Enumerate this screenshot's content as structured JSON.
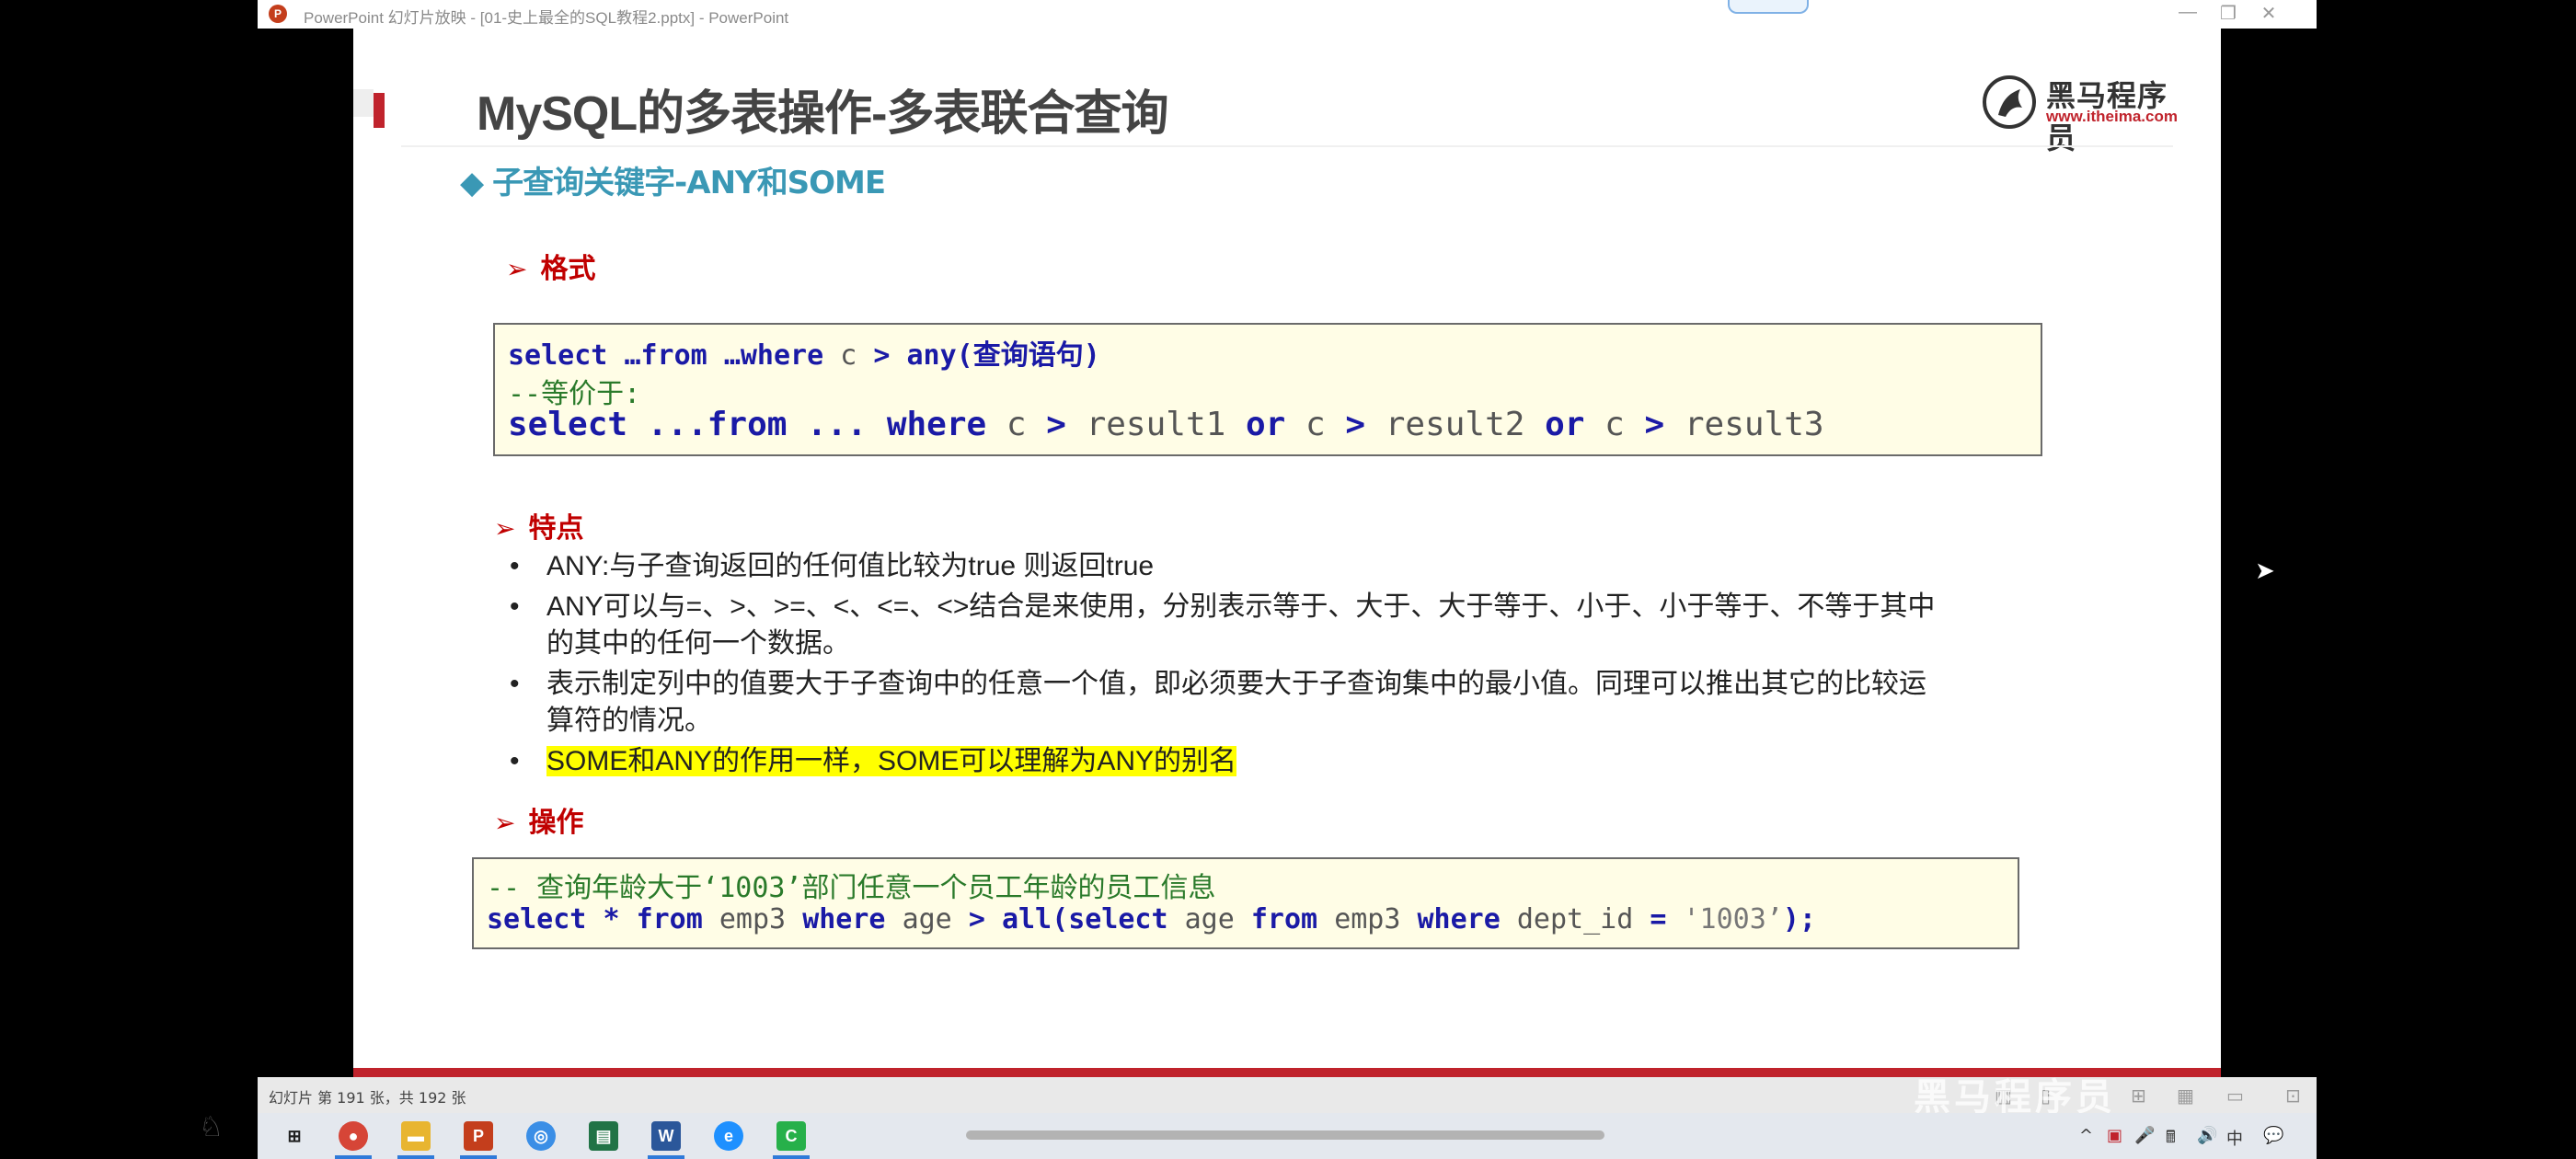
{
  "window": {
    "title": "PowerPoint 幻灯片放映 - [01-史上最全的SQL教程2.pptx] - PowerPoint",
    "app_icon": "P",
    "controls": [
      "—",
      "❐",
      "✕"
    ]
  },
  "slide": {
    "title": "MySQL的多表操作-多表联合查询",
    "logo": {
      "name": "黑马程序员",
      "url": "www.itheima.com"
    },
    "subtitle_marker": "◆",
    "subtitle": "子查询关键字-ANY和SOME",
    "sections": {
      "format": "格式",
      "features": "特点",
      "operation": "操作"
    },
    "section_arrow": "➢",
    "format_code": [
      [
        {
          "t": "select ",
          "k": "kw"
        },
        {
          "t": "…from ",
          "k": "kw"
        },
        {
          "t": "…where ",
          "k": "kw"
        },
        {
          "t": "c ",
          "k": ""
        },
        {
          "t": "> ",
          "k": "kw"
        },
        {
          "t": "any(查询语句)",
          "k": "kw"
        }
      ],
      [
        {
          "t": "--等价于:",
          "k": "cm"
        }
      ],
      [
        {
          "t": "select ",
          "k": "kw"
        },
        {
          "t": "...from ",
          "k": "kw"
        },
        {
          "t": "... ",
          "k": "kw"
        },
        {
          "t": "where ",
          "k": "kw"
        },
        {
          "t": "c ",
          "k": ""
        },
        {
          "t": "> ",
          "k": "kw"
        },
        {
          "t": "result1 ",
          "k": ""
        },
        {
          "t": "or ",
          "k": "kw"
        },
        {
          "t": "c ",
          "k": ""
        },
        {
          "t": "> ",
          "k": "kw"
        },
        {
          "t": "result2 ",
          "k": ""
        },
        {
          "t": "or ",
          "k": "kw"
        },
        {
          "t": "c ",
          "k": ""
        },
        {
          "t": "> ",
          "k": "kw"
        },
        {
          "t": "result3",
          "k": ""
        }
      ]
    ],
    "features": [
      {
        "text": "ANY:与子查询返回的任何值比较为true 则返回true",
        "highlight": false
      },
      {
        "text": "ANY可以与=、>、>=、<、<=、<>结合是来使用，分别表示等于、大于、大于等于、小于、小于等于、不等于其中的其中的任何一个数据。",
        "highlight": false
      },
      {
        "text": "表示制定列中的值要大于子查询中的任意一个值，即必须要大于子查询集中的最小值。同理可以推出其它的比较运算符的情况。",
        "highlight": false
      },
      {
        "text": "SOME和ANY的作用一样，SOME可以理解为ANY的别名",
        "highlight": true
      }
    ],
    "bullet_char": "•",
    "op_code": [
      [
        {
          "t": "-- 查询年龄大于‘1003’部门任意一个员工年龄的员工信息",
          "k": "cm"
        }
      ],
      [
        {
          "t": "select ",
          "k": "kw"
        },
        {
          "t": "* ",
          "k": "kw"
        },
        {
          "t": "from ",
          "k": "kw"
        },
        {
          "t": "emp3 ",
          "k": ""
        },
        {
          "t": "where ",
          "k": "kw"
        },
        {
          "t": "age ",
          "k": ""
        },
        {
          "t": "> ",
          "k": "kw"
        },
        {
          "t": "all(",
          "k": "kw"
        },
        {
          "t": "select ",
          "k": "kw"
        },
        {
          "t": "age ",
          "k": ""
        },
        {
          "t": "from ",
          "k": "kw"
        },
        {
          "t": "emp3 ",
          "k": ""
        },
        {
          "t": "where ",
          "k": "kw"
        },
        {
          "t": "dept_id ",
          "k": ""
        },
        {
          "t": "= ",
          "k": "kw"
        },
        {
          "t": "'1003’",
          "k": "str"
        },
        {
          "t": ");",
          "k": "kw"
        }
      ]
    ]
  },
  "statusbar": {
    "slide_counter": "幻灯片 第 191 张，共 192 张",
    "watermark": "黑马程序员"
  },
  "taskbar": {
    "apps": [
      {
        "name": "windows-start",
        "glyph": "⊞",
        "color": "#1e1e1e"
      },
      {
        "name": "chrome",
        "glyph": "●",
        "color": "#d64537"
      },
      {
        "name": "file-explorer",
        "glyph": "▬",
        "color": "#e8b530"
      },
      {
        "name": "powerpoint",
        "glyph": "P",
        "color": "#c43e1c"
      },
      {
        "name": "browser-2",
        "glyph": "◎",
        "color": "#3a8ee6"
      },
      {
        "name": "excel-chart",
        "glyph": "▤",
        "color": "#217346"
      },
      {
        "name": "word",
        "glyph": "W",
        "color": "#2b579a"
      },
      {
        "name": "edge",
        "glyph": "e",
        "color": "#1e90ff"
      },
      {
        "name": "green-app",
        "glyph": "C",
        "color": "#27b04a"
      }
    ],
    "tray": [
      "^",
      "▣",
      "🎤",
      "🖩",
      "🔊",
      "中",
      "💬"
    ]
  },
  "colors": {
    "title_gray": "#444444",
    "subtitle_teal": "#3a98b5",
    "section_red": "#c00000",
    "code_keyword": "#1a1aa6",
    "code_comment": "#2a7a2a",
    "code_bg": "#fffde6",
    "highlight": "#ffff00",
    "slide_bottom_line": "#c0232c"
  }
}
